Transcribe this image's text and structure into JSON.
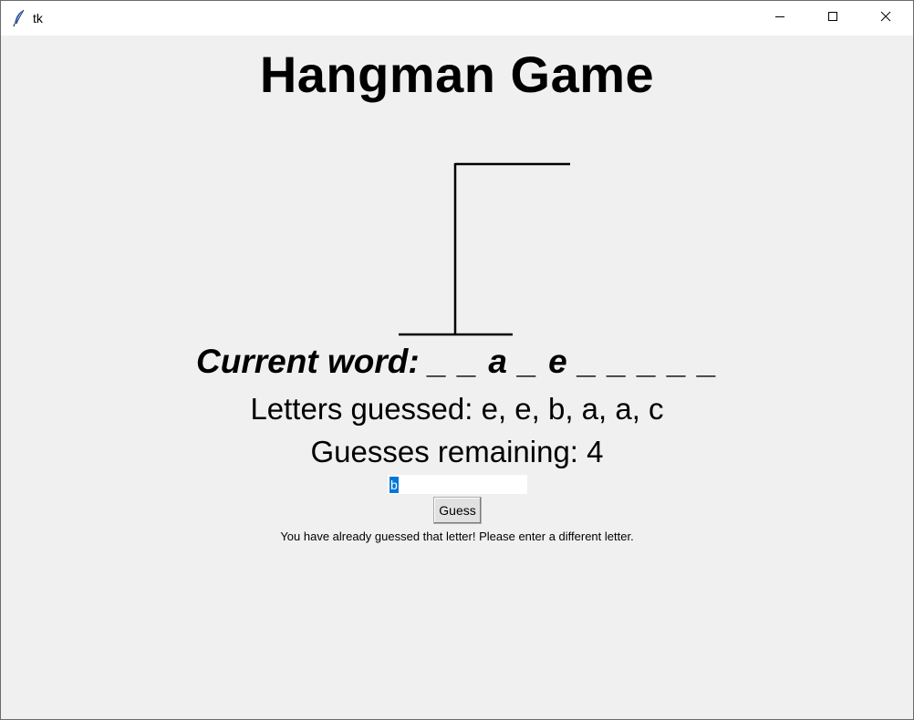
{
  "window": {
    "title": "tk",
    "icon": "feather-icon",
    "controls": [
      "minimize-icon",
      "maximize-icon",
      "close-icon"
    ]
  },
  "game": {
    "title": "Hangman Game",
    "current_word_label": "Current word:",
    "current_word_value": "_ _ a _ e _ _ _ _ _",
    "letters_guessed": "Letters guessed: e, e, b, a, a, c",
    "guesses_remaining": "Guesses remaining: 4",
    "input_value": "b",
    "guess_button_label": "Guess",
    "message": "You have already guessed that letter! Please enter a different letter."
  },
  "colors": {
    "background": "#f0f0f0",
    "titlebar": "#ffffff",
    "selection": "#0078d7"
  }
}
